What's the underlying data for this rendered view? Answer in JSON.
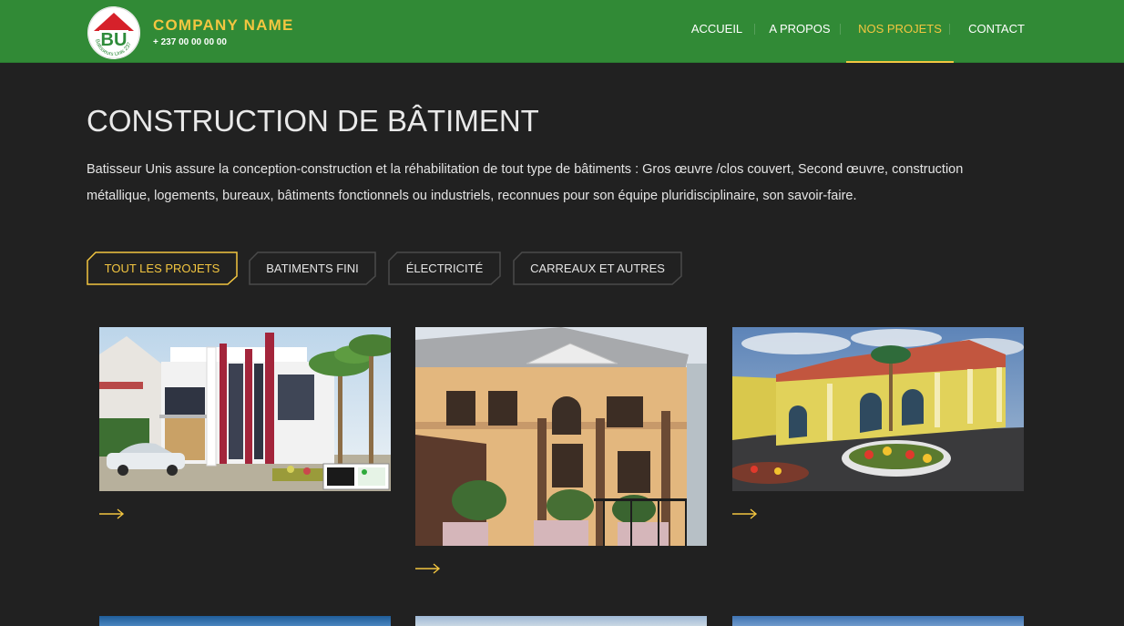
{
  "header": {
    "brand_name": "COMPANY NAME",
    "phone": "+ 237 00 00 00 00",
    "logo_text": "BU",
    "logo_ring_text": "Batisseurs Unis 237",
    "nav": [
      {
        "label": "ACCUEIL",
        "active": false
      },
      {
        "label": "A PROPOS",
        "active": false
      },
      {
        "label": "NOS PROJETS",
        "active": true
      },
      {
        "label": "CONTACT",
        "active": false
      }
    ]
  },
  "main": {
    "title": "CONSTRUCTION DE BÂTIMENT",
    "intro": "Batisseur Unis assure la conception-construction et la réhabilitation de tout type de bâtiments : Gros œuvre /clos couvert, Second œuvre, construction métallique, logements, bureaux, bâtiments fonctionnels ou industriels, reconnues pour son équipe pluridisciplinaire, son savoir-faire.",
    "filters": [
      {
        "label": "TOUT LES PROJETS",
        "active": true
      },
      {
        "label": "BATIMENTS FINI",
        "active": false
      },
      {
        "label": "ÉLECTRICITÉ",
        "active": false
      },
      {
        "label": "CARREAUX ET AUTRES",
        "active": false
      }
    ],
    "projects": [
      {
        "image": "modern-white-villa-photo",
        "arrow_icon": "arrow-right-icon"
      },
      {
        "image": "yellow-two-story-house-photo",
        "arrow_icon": "arrow-right-icon"
      },
      {
        "image": "yellow-bungalow-render-photo",
        "arrow_icon": "arrow-right-icon"
      }
    ]
  },
  "colors": {
    "header_green": "#318a36",
    "accent_gold": "#f3c640",
    "background": "#212121",
    "text": "#e4e4e4"
  }
}
